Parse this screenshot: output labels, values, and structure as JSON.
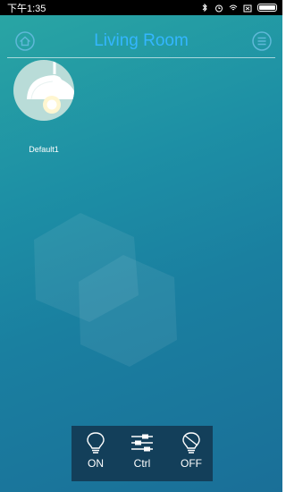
{
  "status": {
    "time": "下午1:35"
  },
  "header": {
    "title": "Living Room"
  },
  "device": {
    "name": "Default1"
  },
  "controls": [
    {
      "label": "ON"
    },
    {
      "label": "Ctrl"
    },
    {
      "label": "OFF"
    }
  ],
  "colors": {
    "title": "#34b6ff",
    "control_bar": "#133f5a",
    "accent_bg": "#1d8fa5"
  },
  "icons": {
    "home": "home-icon",
    "menu": "menu-icon",
    "on": "bulb-icon",
    "ctrl": "sliders-icon",
    "off": "bulb-off-icon"
  }
}
